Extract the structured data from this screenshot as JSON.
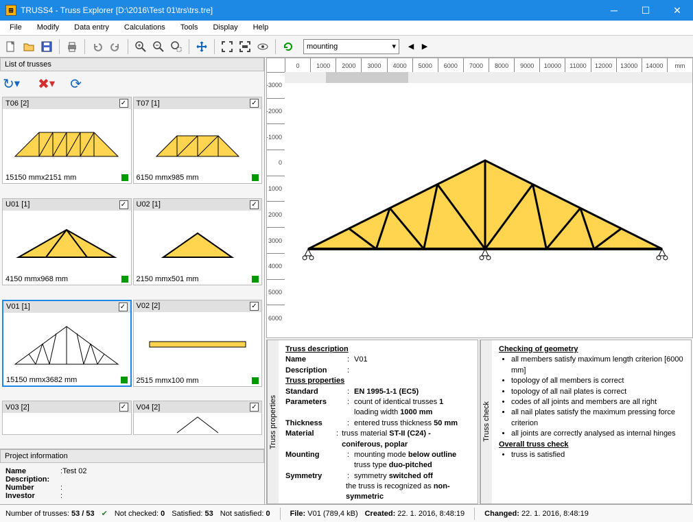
{
  "title": "TRUSS4 - Truss Explorer [D:\\2016\\Test 01\\trs\\trs.tre]",
  "menu": [
    "File",
    "Modify",
    "Data entry",
    "Calculations",
    "Tools",
    "Display",
    "Help"
  ],
  "dropdown": {
    "value": "mounting"
  },
  "left_panel_title": "List of trusses",
  "trusses": [
    {
      "name": "T06 [2]",
      "dim": "15150 mmx2151 mm"
    },
    {
      "name": "T07 [1]",
      "dim": "6150 mmx985 mm"
    },
    {
      "name": "U01 [1]",
      "dim": "4150 mmx968 mm"
    },
    {
      "name": "U02 [1]",
      "dim": "2150 mmx501 mm"
    },
    {
      "name": "V01 [1]",
      "dim": "15150 mmx3682 mm",
      "selected": true
    },
    {
      "name": "V02 [2]",
      "dim": "2515 mmx100 mm"
    },
    {
      "name": "V03 [2]",
      "dim": ""
    },
    {
      "name": "V04 [2]",
      "dim": ""
    }
  ],
  "proj_title": "Project information",
  "proj": {
    "name_l": "Name",
    "name_v": "Test 02",
    "desc_l": "Description:",
    "num_l": "Number",
    "inv_l": "Investor"
  },
  "ruler_h": [
    "0",
    "1000",
    "2000",
    "3000",
    "4000",
    "5000",
    "6000",
    "7000",
    "8000",
    "9000",
    "10000",
    "11000",
    "12000",
    "13000",
    "14000"
  ],
  "ruler_h_unit": "mm",
  "ruler_v": [
    "-3000",
    "-2000",
    "-1000",
    "0",
    "1000",
    "2000",
    "3000",
    "4000",
    "5000",
    "6000"
  ],
  "tp_title": "Truss properties",
  "tp_tab": "Truss properties",
  "tc_tab": "Truss check",
  "tp": {
    "td": "Truss description",
    "name_l": "Name",
    "name_v": "V01",
    "desc_l": "Description",
    "props": "Truss properties",
    "std_l": "Standard",
    "std_v": "EN 1995-1-1 (EC5)",
    "par_l": "Parameters",
    "par_v1": "count of identical trusses ",
    "par_v1b": "1",
    "par_v2": "loading width ",
    "par_v2b": "1000 mm",
    "thk_l": "Thickness",
    "thk_v": "entered truss thickness ",
    "thk_vb": "50 mm",
    "mat_l": "Material",
    "mat_v1": "truss material ",
    "mat_v1b": "ST-II (C24) - coniferous, poplar",
    "mnt_l": "Mounting",
    "mnt_v1": "mounting mode ",
    "mnt_v1b": "below outline",
    "mnt_v2": "truss type ",
    "mnt_v2b": "duo-pitched",
    "sym_l": "Symmetry",
    "sym_v1": "symmetry ",
    "sym_v1b": "switched off",
    "sym_v2": "the truss is recognized as ",
    "sym_v2b": "non-symmetric"
  },
  "tc": {
    "cg": "Checking of geometry",
    "c1": "all members satisfy maximum length criterion [6000 mm]",
    "c2": "topology of all members is correct",
    "c3": "topology of all nail plates is correct",
    "c4": "codes of all joints and members are all right",
    "c5": "all nail plates satisfy the maximum pressing force criterion",
    "c6": "all joints are correctly analysed as internal hinges",
    "oc": "Overall truss check",
    "oc1": "truss is satisfied"
  },
  "status": {
    "s1l": "Number of trusses: ",
    "s1v": "53 / 53",
    "s2l": "Not checked: ",
    "s2v": "0",
    "s3l": "Satisfied: ",
    "s3v": "53",
    "s4l": "Not satisfied: ",
    "s4v": "0",
    "fl": "File: ",
    "fv": "V01 (789,4 kB)",
    "cl": "Created: ",
    "cv": "22. 1. 2016, 8:48:19",
    "chl": "Changed: ",
    "chv": "22. 1. 2016, 8:48:19"
  }
}
